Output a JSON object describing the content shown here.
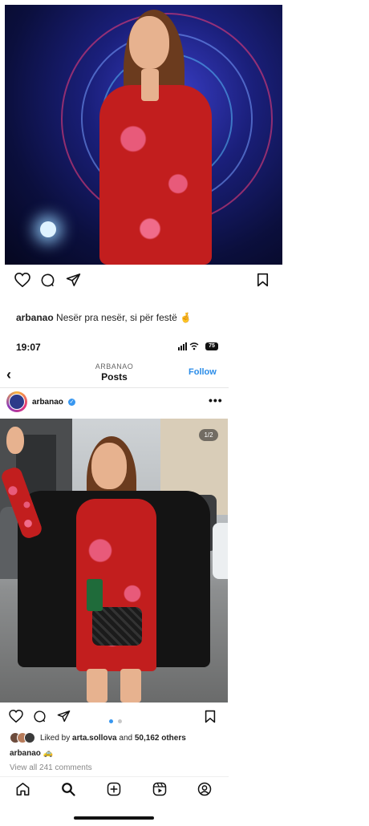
{
  "top_post": {
    "username": "arbanao",
    "caption": "Nesër pra nesër, si për festë",
    "caption_emoji": "🤞"
  },
  "embedded": {
    "status_time": "19:07",
    "battery": "75",
    "nav": {
      "back_glyph": "‹",
      "account_label": "ARBANAO",
      "title": "Posts",
      "follow_label": "Follow"
    },
    "post": {
      "username": "arbanao",
      "verified_glyph": "✓",
      "more_glyph": "•••",
      "image_counter": "1/2",
      "liked_prefix": "Liked by ",
      "liked_user": "arta.sollova",
      "liked_middle": " and ",
      "liked_count": "50,162 others",
      "caption_user": "arbanao",
      "caption_emoji": "🚕",
      "view_comments": "View all 241 comments"
    }
  },
  "icons": [
    "heart-icon",
    "comment-icon",
    "share-icon",
    "bookmark-icon",
    "home-icon",
    "search-icon",
    "add-post-icon",
    "reels-icon",
    "profile-icon",
    "verified-icon"
  ],
  "colors": {
    "accent": "#2a8ce8",
    "dress": "#c21e1e",
    "verified": "#3897f0"
  }
}
